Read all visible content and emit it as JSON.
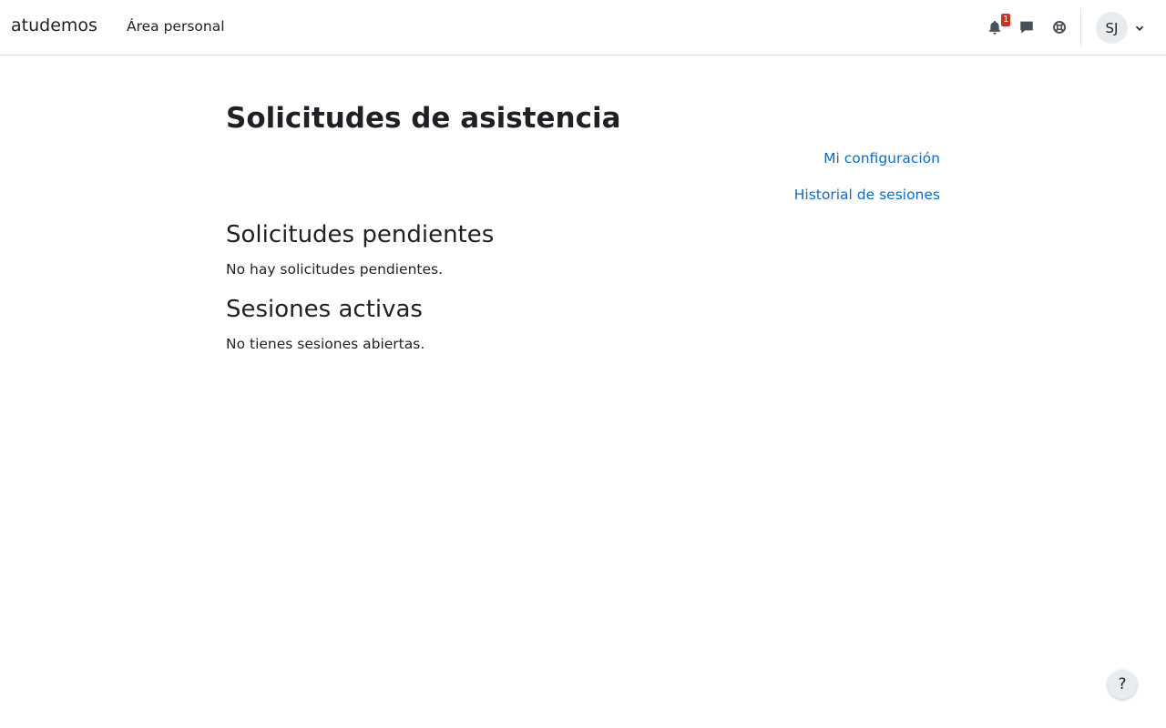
{
  "navbar": {
    "brand": "atudemos",
    "nav_link": "Área personal",
    "notifications_count": "1",
    "user_initials": "SJ",
    "icons": [
      "bell-icon",
      "chat-bubble-icon",
      "lifebuoy-icon",
      "chevron-down-icon"
    ]
  },
  "page": {
    "title": "Solicitudes de asistencia",
    "links": {
      "config": "Mi configuración",
      "history": "Historial de sesiones"
    },
    "pending": {
      "heading": "Solicitudes pendientes",
      "text": "No hay solicitudes pendientes."
    },
    "active": {
      "heading": "Sesiones activas",
      "text": "No tienes sesiones abiertas."
    }
  },
  "footer": {
    "help_label": "?"
  },
  "colors": {
    "link": "#0f6cbf",
    "text": "#1d2125",
    "badge": "#ca3120",
    "avatar_bg": "#e9ecef"
  }
}
